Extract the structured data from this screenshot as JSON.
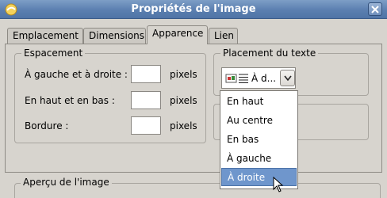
{
  "window": {
    "title": "Propriétés de l'image"
  },
  "tabs": [
    {
      "label": "Emplacement",
      "active": false
    },
    {
      "label": "Dimensions",
      "active": false
    },
    {
      "label": "Apparence",
      "active": true
    },
    {
      "label": "Lien",
      "active": false
    }
  ],
  "spacing": {
    "legend": "Espacement",
    "rows": [
      {
        "label": "À gauche et à droite :",
        "value": "",
        "unit": "pixels"
      },
      {
        "label": "En haut et en bas :",
        "value": "",
        "unit": "pixels"
      },
      {
        "label": "Bordure :",
        "value": "",
        "unit": "pixels"
      }
    ]
  },
  "text_placement": {
    "legend": "Placement du texte",
    "selected": "À d...",
    "options": [
      {
        "label": "En haut",
        "highlighted": false
      },
      {
        "label": "Au centre",
        "highlighted": false
      },
      {
        "label": "En bas",
        "highlighted": false
      },
      {
        "label": "À gauche",
        "highlighted": false
      },
      {
        "label": "À droite",
        "highlighted": true
      }
    ]
  },
  "preview": {
    "legend": "Aperçu de l'image"
  },
  "colors": {
    "titlebar": "#5b7fb0",
    "highlight": "#6f96cc",
    "dialog_bg": "#d7d4ce"
  }
}
